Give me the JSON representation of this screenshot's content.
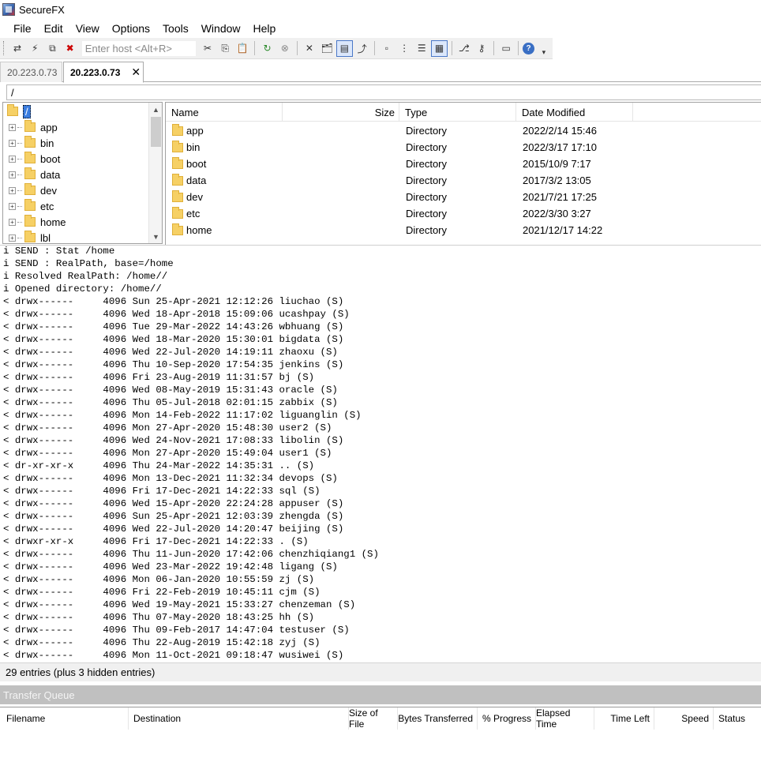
{
  "window": {
    "title": "SecureFX"
  },
  "menu": [
    "File",
    "Edit",
    "View",
    "Options",
    "Tools",
    "Window",
    "Help"
  ],
  "toolbar": {
    "host_placeholder": "Enter host <Alt+R>"
  },
  "tabs": [
    {
      "label": "20.223.0.73",
      "active": false
    },
    {
      "label": "20.223.0.73",
      "active": true
    }
  ],
  "path": "/",
  "tree": {
    "root": "/",
    "items": [
      "app",
      "bin",
      "boot",
      "data",
      "dev",
      "etc",
      "home",
      "lbl"
    ]
  },
  "filelist": {
    "columns": [
      "Name",
      "Size",
      "Type",
      "Date Modified"
    ],
    "rows": [
      {
        "name": "app",
        "size": "",
        "type": "Directory",
        "date": "2022/2/14 15:46"
      },
      {
        "name": "bin",
        "size": "",
        "type": "Directory",
        "date": "2022/3/17 17:10"
      },
      {
        "name": "boot",
        "size": "",
        "type": "Directory",
        "date": "2015/10/9 7:17"
      },
      {
        "name": "data",
        "size": "",
        "type": "Directory",
        "date": "2017/3/2 13:05"
      },
      {
        "name": "dev",
        "size": "",
        "type": "Directory",
        "date": "2021/7/21 17:25"
      },
      {
        "name": "etc",
        "size": "",
        "type": "Directory",
        "date": "2022/3/30 3:27"
      },
      {
        "name": "home",
        "size": "",
        "type": "Directory",
        "date": "2021/12/17 14:22"
      }
    ]
  },
  "log": [
    "i SEND : Stat /home",
    "i SEND : RealPath, base=/home",
    "i Resolved RealPath: /home//",
    "i Opened directory: /home//",
    "< drwx------     4096 Sun 25-Apr-2021 12:12:26 liuchao (S)",
    "< drwx------     4096 Wed 18-Apr-2018 15:09:06 ucashpay (S)",
    "< drwx------     4096 Tue 29-Mar-2022 14:43:26 wbhuang (S)",
    "< drwx------     4096 Wed 18-Mar-2020 15:30:01 bigdata (S)",
    "< drwx------     4096 Wed 22-Jul-2020 14:19:11 zhaoxu (S)",
    "< drwx------     4096 Thu 10-Sep-2020 17:54:35 jenkins (S)",
    "< drwx------     4096 Fri 23-Aug-2019 11:31:57 bj (S)",
    "< drwx------     4096 Wed 08-May-2019 15:31:43 oracle (S)",
    "< drwx------     4096 Thu 05-Jul-2018 02:01:15 zabbix (S)",
    "< drwx------     4096 Mon 14-Feb-2022 11:17:02 liguanglin (S)",
    "< drwx------     4096 Mon 27-Apr-2020 15:48:30 user2 (S)",
    "< drwx------     4096 Wed 24-Nov-2021 17:08:33 libolin (S)",
    "< drwx------     4096 Mon 27-Apr-2020 15:49:04 user1 (S)",
    "< dr-xr-xr-x     4096 Thu 24-Mar-2022 14:35:31 .. (S)",
    "< drwx------     4096 Mon 13-Dec-2021 11:32:34 devops (S)",
    "< drwx------     4096 Fri 17-Dec-2021 14:22:33 sql (S)",
    "< drwx------     4096 Wed 15-Apr-2020 22:24:28 appuser (S)",
    "< drwx------     4096 Sun 25-Apr-2021 12:03:39 zhengda (S)",
    "< drwx------     4096 Wed 22-Jul-2020 14:20:47 beijing (S)",
    "< drwxr-xr-x     4096 Fri 17-Dec-2021 14:22:33 . (S)",
    "< drwx------     4096 Thu 11-Jun-2020 17:42:06 chenzhiqiang1 (S)",
    "< drwx------     4096 Wed 23-Mar-2022 19:42:48 ligang (S)",
    "< drwx------     4096 Mon 06-Jan-2020 10:55:59 zj (S)",
    "< drwx------     4096 Fri 22-Feb-2019 10:45:11 cjm (S)",
    "< drwx------     4096 Wed 19-May-2021 15:33:27 chenzeman (S)",
    "< drwx------     4096 Thu 07-May-2020 18:43:25 hh (S)",
    "< drwx------     4096 Thu 09-Feb-2017 14:47:04 testuser (S)",
    "< drwx------     4096 Thu 22-Aug-2019 15:42:18 zyj (S)",
    "< drwx------     4096 Mon 11-Oct-2021 09:18:47 wusiwei (S)"
  ],
  "status": "29 entries (plus 3 hidden entries)",
  "transfer_queue": {
    "title": "Transfer Queue",
    "columns": [
      "Filename",
      "Destination",
      "Size of File",
      "Bytes Transferred",
      "% Progress",
      "Elapsed Time",
      "Time Left",
      "Speed",
      "Status"
    ]
  },
  "colors": {
    "selection": "#3b7de0",
    "folder": "#f6d065",
    "queue_bar": "#c0c0c0"
  }
}
